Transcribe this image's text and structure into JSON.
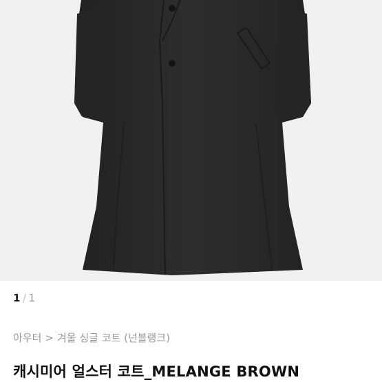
{
  "product_image": {
    "alt": "coat-photo",
    "icon": "coat-image"
  },
  "pager": {
    "current": "1",
    "separator": "/",
    "total": "1"
  },
  "breadcrumb": {
    "items": [
      "아우터",
      "겨울 싱글 코트 (넌블랭크)"
    ],
    "separator": ">"
  },
  "product": {
    "title": "캐시미어 얼스터 코트_MELANGE BROWN"
  },
  "colors": {
    "background": "#ffffff",
    "photo_background": "#f1f1f1",
    "coat": "#2a2927"
  }
}
